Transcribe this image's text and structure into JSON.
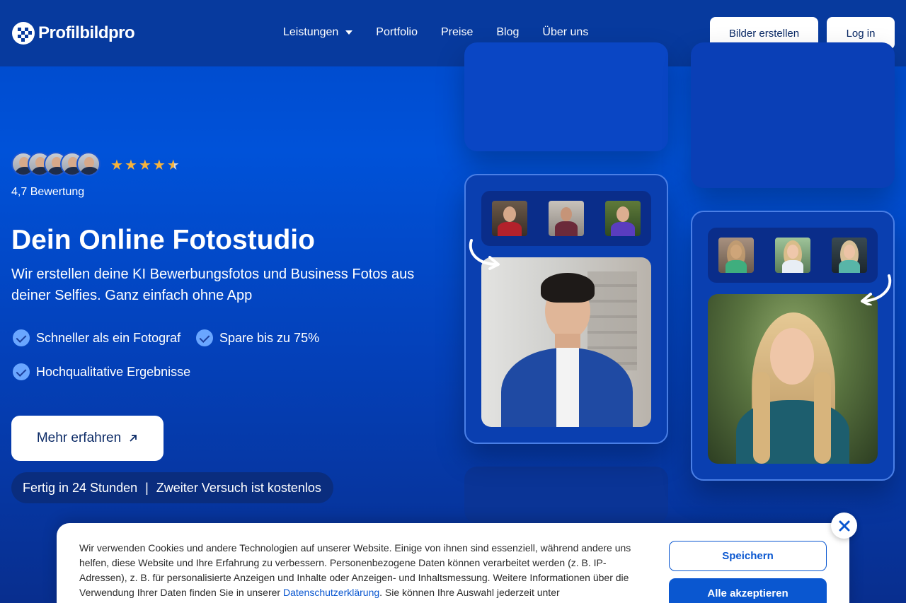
{
  "brand": {
    "name": "Profilbildpro"
  },
  "nav": {
    "items": [
      "Leistungen",
      "Portfolio",
      "Preise",
      "Blog",
      "Über uns"
    ]
  },
  "header": {
    "create_label": "Bilder erstellen",
    "login_label": "Log in"
  },
  "hero": {
    "rating_value": 4.7,
    "rating_text": "4,7 Bewertung",
    "title": "Dein Online Fotostudio",
    "subtitle": "Wir erstellen deine KI Bewerbungsfotos und Business Fotos aus deiner Selfies. Ganz einfach ohne App",
    "features": [
      "Schneller als ein Fotograf",
      "Spare bis zu 75%",
      "Hochqualitative Ergebnisse"
    ],
    "cta_label": "Mehr erfahren",
    "pill_left": "Fertig in 24 Stunden",
    "pill_sep": "|",
    "pill_right": "Zweiter Versuch ist kostenlos"
  },
  "colors": {
    "accent": "#0a57d0",
    "star": "#f6b33d",
    "check": "#6aa6ff"
  },
  "icons": {
    "check": "check-badge-icon",
    "star": "star-icon",
    "external": "arrow-up-right-icon",
    "close": "close-icon",
    "caret": "chevron-down-icon"
  },
  "cookie": {
    "text_before_link": "Wir verwenden Cookies und andere Technologien auf unserer Website. Einige von ihnen sind essenziell, während andere uns helfen, diese Website und Ihre Erfahrung zu verbessern. Personenbezogene Daten können verarbeitet werden (z. B. IP-Adressen), z. B. für personalisierte Anzeigen und Inhalte oder Anzeigen- und Inhaltsmessung. Weitere Informationen über die Verwendung Ihrer Daten finden Sie in unserer ",
    "link_text": "Datenschutzerklärung",
    "text_after_link": ". Sie können Ihre Auswahl jederzeit unter",
    "save_label": "Speichern",
    "accept_label": "Alle akzeptieren"
  }
}
